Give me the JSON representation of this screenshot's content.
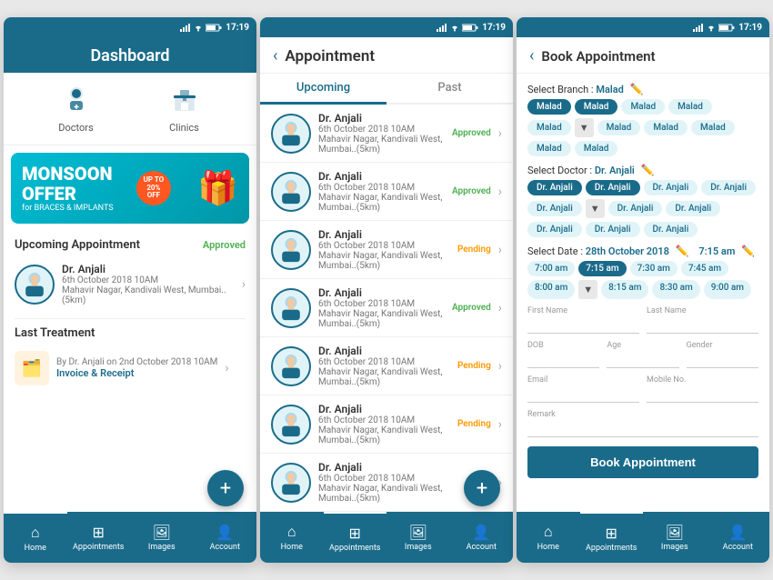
{
  "screen1": {
    "status_time": "17:19",
    "header_title": "Dashboard",
    "icons": [
      {
        "label": "Doctors",
        "icon": "👨‍⚕️"
      },
      {
        "label": "Clinics",
        "icon": "🏥"
      }
    ],
    "banner": {
      "line1": "MONSOON",
      "line2": "OFFER",
      "sub": "for BRACES & IMPLANTS",
      "badge_top": "UP TO",
      "badge_mid": "20%",
      "badge_bot": "OFF"
    },
    "upcoming_label": "Upcoming Appointment",
    "upcoming_status": "Approved",
    "appointment": {
      "name": "Dr. Anjali",
      "date": "6th October 2018 10AM",
      "location": "Mahavir Nagar, Kandivali West, Mumbai..(5km)"
    },
    "last_treatment_label": "Last Treatment",
    "last_treatment": {
      "by": "By Dr. Anjali on 2nd October 2018 10AM",
      "link": "Invoice & Receipt"
    },
    "nav": [
      "Home",
      "Appointments",
      "Images",
      "Account"
    ]
  },
  "screen2": {
    "status_time": "17:19",
    "header_title": "Appointment",
    "tab_upcoming": "Upcoming",
    "tab_past": "Past",
    "appointments": [
      {
        "name": "Dr. Anjali",
        "date": "6th October 2018 10AM",
        "location": "Mahavir Nagar, Kandivali West, Mumbai..(5km)",
        "status": "Approved",
        "type": "approved"
      },
      {
        "name": "Dr. Anjali",
        "date": "6th October 2018 10AM",
        "location": "Mahavir Nagar, Kandivali West, Mumbai..(5km)",
        "status": "Approved",
        "type": "approved"
      },
      {
        "name": "Dr. Anjali",
        "date": "6th October 2018 10AM",
        "location": "Mahavir Nagar, Kandivali West, Mumbai..(5km)",
        "status": "Pending",
        "type": "pending"
      },
      {
        "name": "Dr. Anjali",
        "date": "6th October 2018 10AM",
        "location": "Mahavir Nagar, Kandivali West, Mumbai..(5km)",
        "status": "Approved",
        "type": "approved"
      },
      {
        "name": "Dr. Anjali",
        "date": "6th October 2018 10AM",
        "location": "Mahavir Nagar, Kandivali West, Mumbai..(5km)",
        "status": "Pending",
        "type": "pending"
      },
      {
        "name": "Dr. Anjali",
        "date": "6th October 2018 10AM",
        "location": "Mahavir Nagar, Kandivali West, Mumbai..(5km)",
        "status": "Pending",
        "type": "pending"
      },
      {
        "name": "Dr. Anjali",
        "date": "6th October 2018 10AM",
        "location": "Mahavir Nagar, Kandivali West, Mumbai..(5km)",
        "status": "App...",
        "type": "app"
      }
    ],
    "nav": [
      "Home",
      "Appointments",
      "Images",
      "Account"
    ]
  },
  "screen3": {
    "status_time": "17:19",
    "header_title": "Book Appointment",
    "branch_label": "Select Branch :",
    "branch_value": "Malad",
    "branches": [
      "Malad",
      "Malad",
      "Malad",
      "Malad",
      "Malad",
      "Malad",
      "Malad",
      "Malad",
      "Malad",
      "Malad"
    ],
    "doctor_label": "Select Doctor :",
    "doctor_value": "Dr. Anjali",
    "doctors": [
      "Dr. Anjali",
      "Dr. Anjali",
      "Dr. Anjali",
      "Dr. Anjali",
      "Dr. Anjali",
      "Dr. Anjali",
      "Dr. Anjali",
      "Dr. Anjali",
      "Dr. Anjali",
      "Dr. Anjali"
    ],
    "date_label": "Select Date :",
    "date_value": "28th October 2018",
    "time_value": "7:15 am",
    "times": [
      {
        "label": "7:00 am",
        "active": false
      },
      {
        "label": "7:15 am",
        "active": true
      },
      {
        "label": "7:30 am",
        "active": false
      },
      {
        "label": "7:45 am",
        "active": false
      },
      {
        "label": "8:00 am",
        "active": false
      },
      {
        "label": "8:15 am",
        "active": false
      },
      {
        "label": "8:30 am",
        "active": false
      },
      {
        "label": "9:00 am",
        "active": false
      }
    ],
    "form": {
      "first_name": "First Name",
      "last_name": "Last Name",
      "dob": "DOB",
      "age": "Age",
      "gender": "Gender",
      "email": "Email",
      "mobile": "Mobile No.",
      "remark": "Remark"
    },
    "book_btn": "Book Appointment",
    "nav": [
      "Home",
      "Appointments",
      "Images",
      "Account"
    ]
  }
}
